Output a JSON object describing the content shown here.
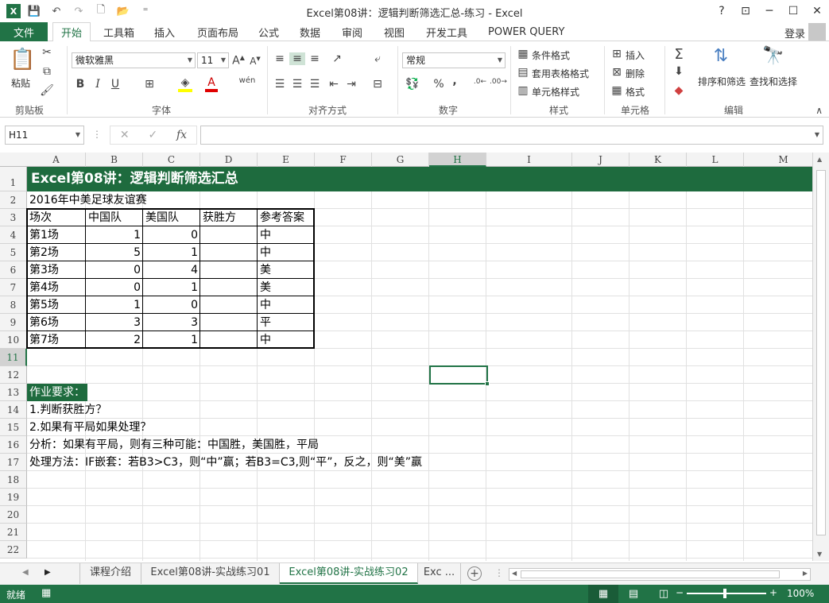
{
  "window": {
    "title": "Excel第08讲：逻辑判断筛选汇总-练习 - Excel",
    "help": "?",
    "ribbon_display": "⊡",
    "minimize": "─",
    "maximize": "☐",
    "close": "✕"
  },
  "qat": {
    "save": "💾",
    "undo": "↶",
    "redo": "↷",
    "new": "🗋",
    "open": "📂",
    "customize": "⁼"
  },
  "tabs": {
    "file": "文件",
    "items": [
      "开始",
      "工具箱",
      "插入",
      "页面布局",
      "公式",
      "数据",
      "审阅",
      "视图",
      "开发工具",
      "POWER QUERY"
    ],
    "login": "登录"
  },
  "ribbon": {
    "clipboard": {
      "paste": "粘贴",
      "label": "剪贴板"
    },
    "font": {
      "name": "微软雅黑",
      "size": "11",
      "label": "字体",
      "bold": "B",
      "italic": "I",
      "underline": "U"
    },
    "alignment": {
      "label": "对齐方式"
    },
    "number": {
      "format": "常规",
      "label": "数字",
      "percent": "%",
      "comma": ","
    },
    "styles": {
      "conditional": "条件格式",
      "table": "套用表格格式",
      "cell": "单元格样式",
      "label": "样式"
    },
    "cells": {
      "insert": "插入",
      "delete": "删除",
      "format": "格式",
      "label": "单元格"
    },
    "editing": {
      "sort": "排序和筛选",
      "find": "查找和选择",
      "label": "编辑"
    }
  },
  "formula_bar": {
    "name_box": "H11",
    "fx": "fx",
    "cancel": "✕",
    "enter": "✓",
    "dots": "⋮",
    "value": ""
  },
  "columns": [
    "A",
    "B",
    "C",
    "D",
    "E",
    "F",
    "G",
    "H",
    "I",
    "J",
    "K",
    "L",
    "M"
  ],
  "rows": [
    "1",
    "2",
    "3",
    "4",
    "5",
    "6",
    "7",
    "8",
    "9",
    "10",
    "11",
    "12",
    "13",
    "14",
    "15",
    "16",
    "17",
    "18",
    "19",
    "20",
    "21",
    "22"
  ],
  "sheet": {
    "banner": "Excel第08讲：逻辑判断筛选汇总",
    "subtitle": "2016年中美足球友谊赛",
    "table_headers": [
      "场次",
      "中国队",
      "美国队",
      "获胜方",
      "参考答案"
    ],
    "table_rows": [
      [
        "第1场",
        "1",
        "0",
        "",
        "中"
      ],
      [
        "第2场",
        "5",
        "1",
        "",
        "中"
      ],
      [
        "第3场",
        "0",
        "4",
        "",
        "美"
      ],
      [
        "第4场",
        "0",
        "1",
        "",
        "美"
      ],
      [
        "第5场",
        "1",
        "0",
        "",
        "中"
      ],
      [
        "第6场",
        "3",
        "3",
        "",
        "平"
      ],
      [
        "第7场",
        "2",
        "1",
        "",
        "中"
      ]
    ],
    "homework_label": "作业要求：",
    "notes": [
      "1.判断获胜方？",
      "2.如果有平局如果处理？",
      "分析：如果有平局，则有三种可能：中国胜，美国胜，平局",
      "处理方法：IF嵌套：若B3>C3，则“中”赢；若B3=C3,则“平”，反之，则“美”赢"
    ]
  },
  "sheet_tabs": [
    "课程介绍",
    "Excel第08讲-实战练习01",
    "Excel第08讲-实战练习02",
    "Exc ..."
  ],
  "sheet_nav": {
    "prev": "◀",
    "next": "▶"
  },
  "status": {
    "ready": "就绪",
    "zoom": "100%",
    "minus": "−",
    "plus": "+"
  },
  "colors": {
    "accent": "#217346",
    "banner": "#1e6b3e"
  }
}
